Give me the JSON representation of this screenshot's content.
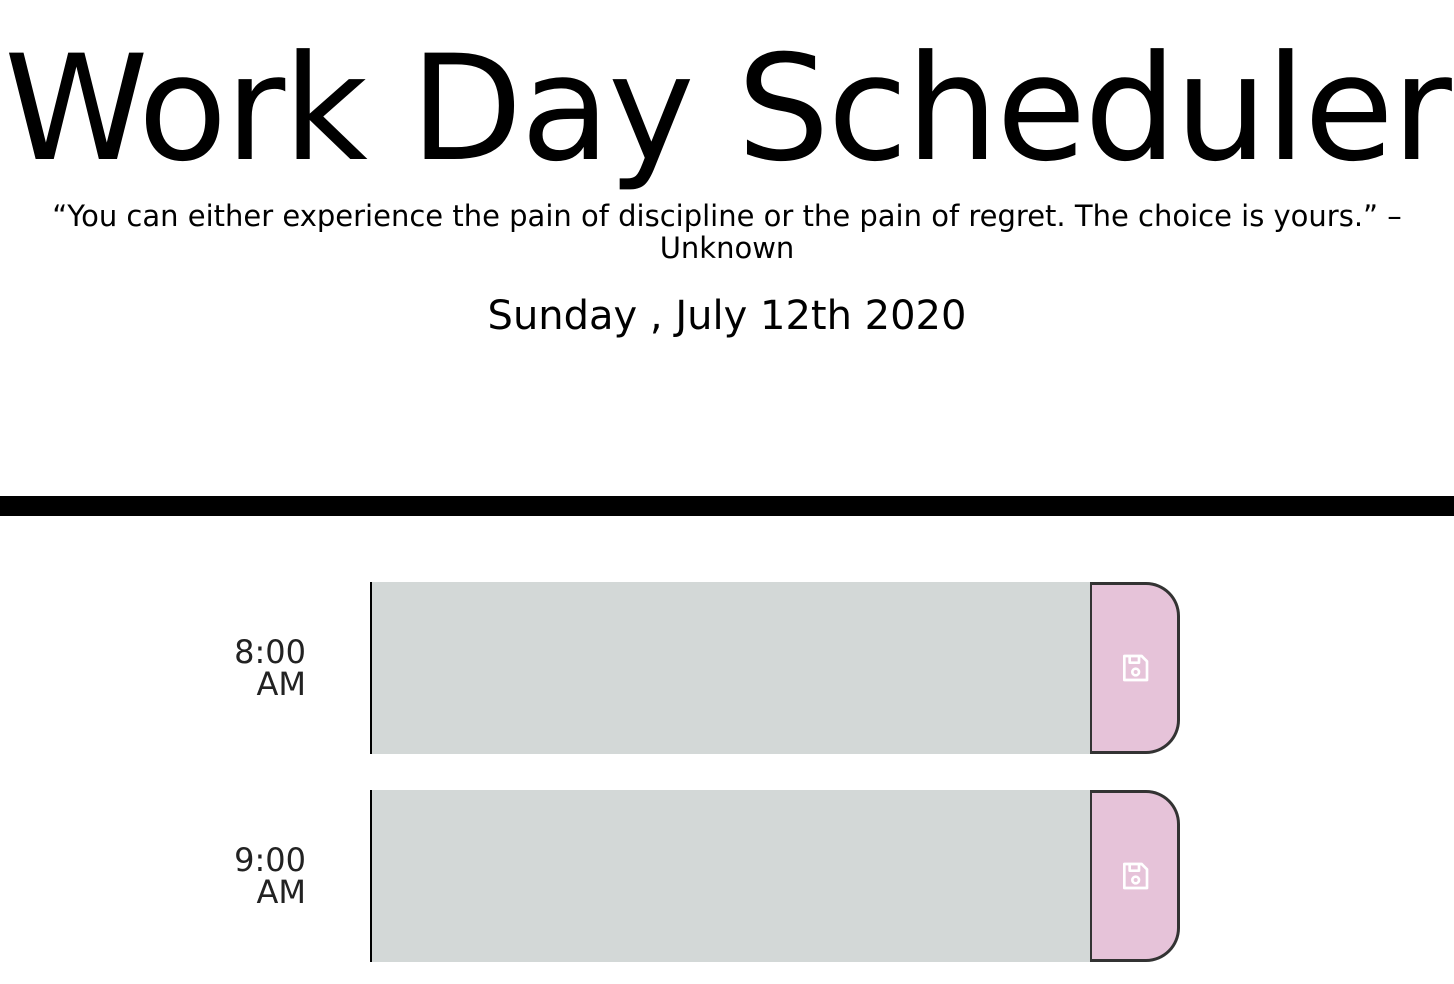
{
  "header": {
    "title": "Work Day Scheduler",
    "quote": "“You can either experience the pain of discipline or the pain of regret. The choice is yours.” – Unknown",
    "current_day": "Sunday , July 12th 2020"
  },
  "time_blocks": [
    {
      "hour_line1": "8:00",
      "hour_line2": "AM",
      "description": "",
      "save_icon": "save-icon"
    },
    {
      "hour_line1": "9:00",
      "hour_line2": "AM",
      "description": "",
      "save_icon": "save-icon"
    }
  ],
  "colors": {
    "description_bg": "#d3d8d7",
    "save_button_bg": "#e6c3d9",
    "divider": "#000000"
  }
}
